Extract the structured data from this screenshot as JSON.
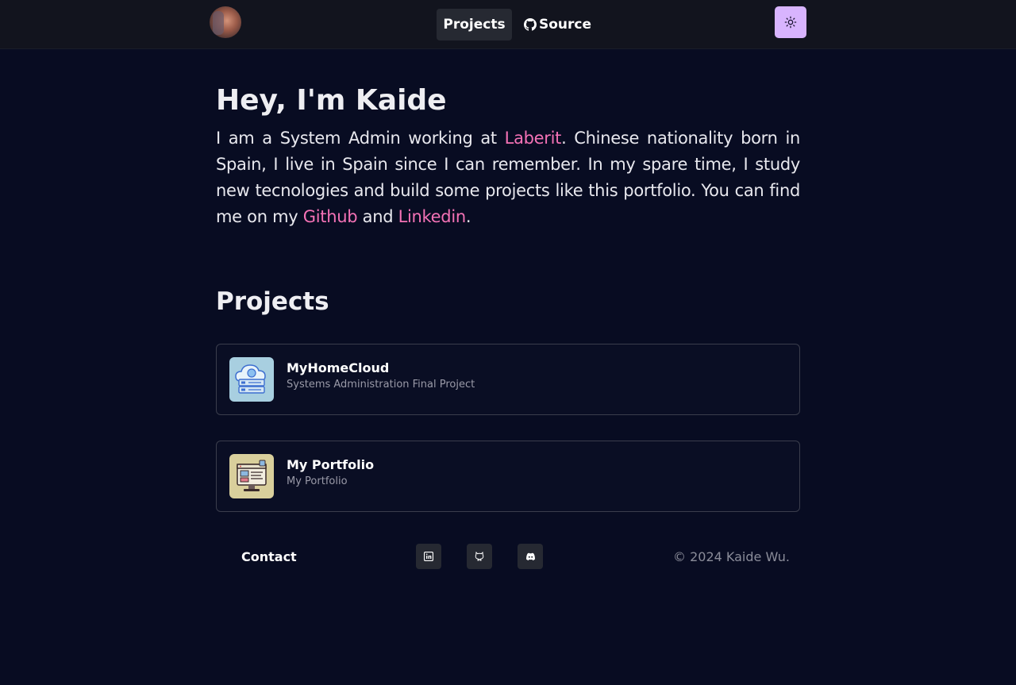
{
  "header": {
    "nav": {
      "projects": "Projects",
      "source": "Source"
    }
  },
  "hero": {
    "title": "Hey, I'm Kaide",
    "part1": "I am a System Admin working at ",
    "link_laberit": "Laberit",
    "part2": ". Chinese nationality born in Spain, I live in Spain since I can remember. In my spare time, I study new tecnologies and build some projects like this portfolio. You can find me on my ",
    "link_github": "Github",
    "part3": " and ",
    "link_linkedin": "Linkedin",
    "part4": "."
  },
  "projects": {
    "title": "Projects",
    "items": [
      {
        "title": "MyHomeCloud",
        "description": "Systems Administration Final Project"
      },
      {
        "title": "My Portfolio",
        "description": "My Portfolio"
      }
    ]
  },
  "footer": {
    "contact": "Contact",
    "social": [
      "linkedin-icon",
      "github-icon",
      "discord-icon"
    ],
    "copyright": "© 2024 Kaide Wu."
  },
  "colors": {
    "background": "#080c22",
    "link": "#f472b6",
    "theme_toggle": "#d8b4fe"
  }
}
